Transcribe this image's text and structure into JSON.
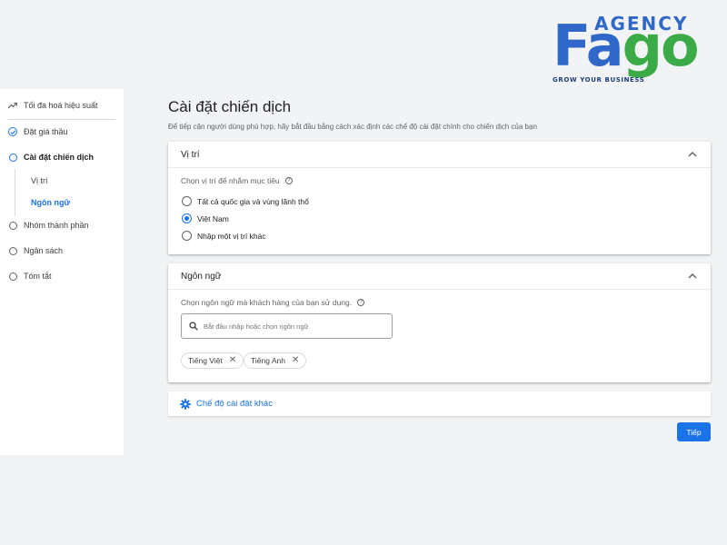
{
  "logo": {
    "agency": "AGENCY",
    "letters": [
      "F",
      "a",
      "g",
      "o"
    ],
    "tagline": "GROW YOUR BUSINESS",
    "colors": {
      "blue": "#2f68c8",
      "green": "#3aab47"
    }
  },
  "sidebar": {
    "items": [
      {
        "label": "Tối đa hoá hiệu suất",
        "icon": "trending-up-icon"
      },
      {
        "label": "Đặt giá thầu",
        "icon": "check-circle-icon"
      },
      {
        "label": "Cài đặt chiến dịch",
        "icon": "current-step-ring-icon"
      },
      {
        "label": "Nhóm thành phần",
        "icon": "step-ring-icon"
      },
      {
        "label": "Ngân sách",
        "icon": "step-ring-icon"
      },
      {
        "label": "Tóm tắt",
        "icon": "step-ring-icon"
      }
    ],
    "sub_items": [
      {
        "label": "Vị trí"
      },
      {
        "label": "Ngôn ngữ",
        "active": true
      }
    ]
  },
  "main": {
    "title": "Cài đặt chiến dịch",
    "subtitle": "Để tiếp cận người dùng phù hợp, hãy bắt đầu bằng cách xác định các chế độ cài đặt chính cho chiến dịch của bạn",
    "location": {
      "title": "Vị trí",
      "question": "Chọn vị trí để nhắm mục tiêu",
      "options": [
        {
          "label": "Tất cả quốc gia và vùng lãnh thổ",
          "selected": false
        },
        {
          "label": "Việt Nam",
          "selected": true
        },
        {
          "label": "Nhập một vị trí khác",
          "selected": false
        }
      ]
    },
    "language": {
      "title": "Ngôn ngữ",
      "question": "Chọn ngôn ngữ mà khách hàng của bạn sử dụng.",
      "search_placeholder": "Bắt đầu nhập hoặc chọn ngôn ngữ",
      "chips": [
        "Tiếng Việt",
        "Tiếng Anh"
      ]
    },
    "more_settings": "Chế độ cài đặt khác",
    "next_button": "Tiếp"
  },
  "colors": {
    "accent": "#1a73e8",
    "background": "#f1f3f4"
  }
}
